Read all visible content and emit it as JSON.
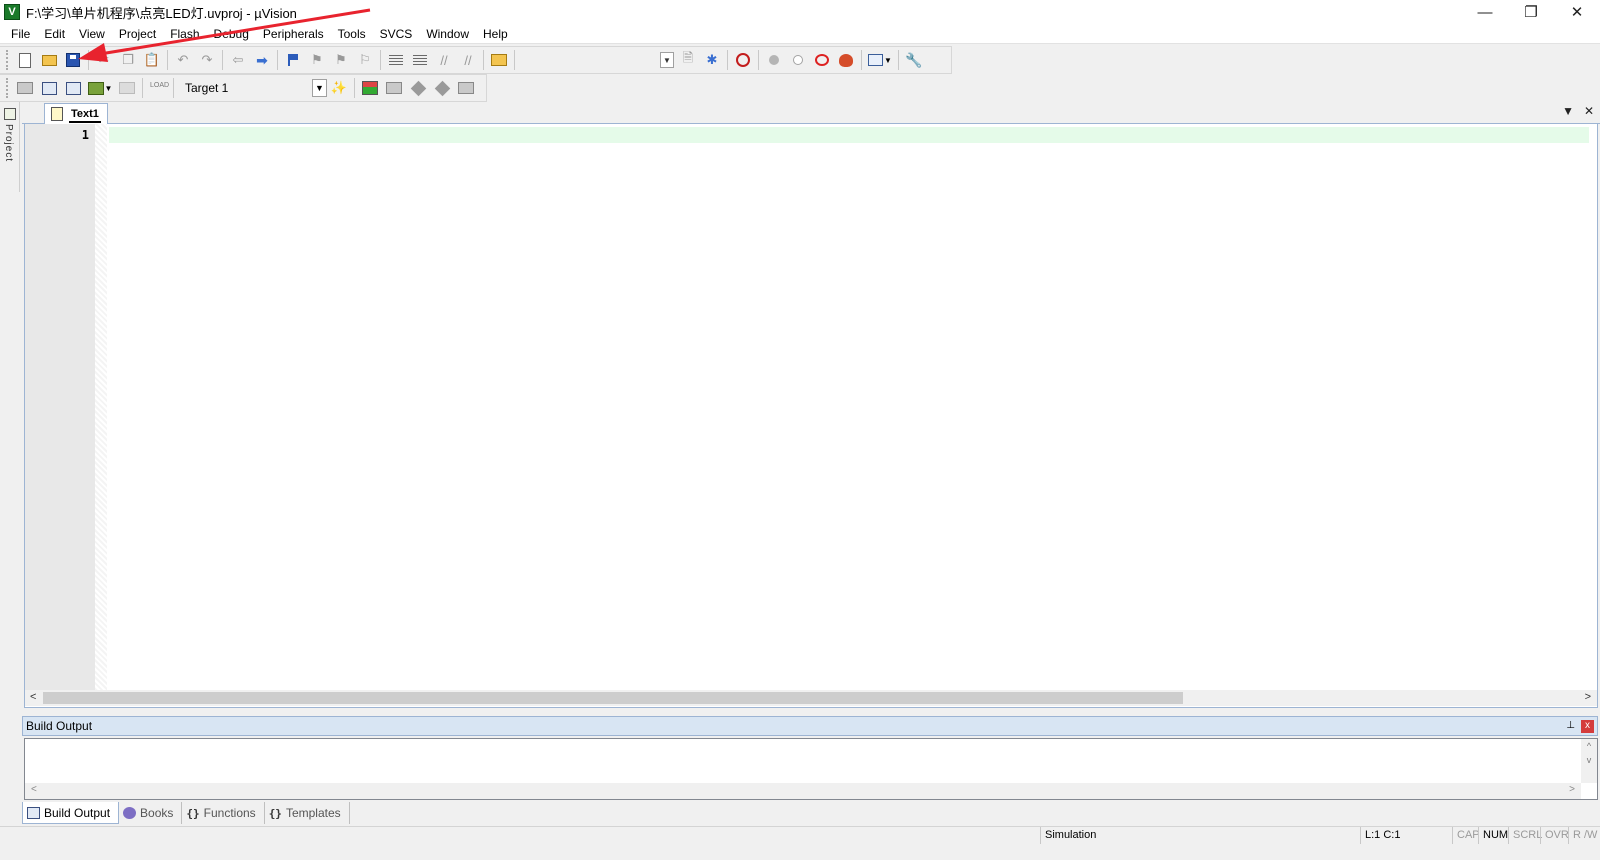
{
  "window": {
    "app_logo": "V",
    "title": "F:\\学习\\单片机程序\\点亮LED灯.uvproj - µVision",
    "controls": {
      "minimize": "—",
      "restore": "❐",
      "close": "✕"
    }
  },
  "menu": [
    "File",
    "Edit",
    "View",
    "Project",
    "Flash",
    "Debug",
    "Peripherals",
    "Tools",
    "SVCS",
    "Window",
    "Help"
  ],
  "toolbar2": {
    "target_label": "Target 1",
    "load_label": "LOAD"
  },
  "left_strip": {
    "label": "Project"
  },
  "editor": {
    "tab_label": "Text1",
    "line_numbers": [
      "1"
    ],
    "tab_menu_icon": "▼",
    "tab_close_icon": "✕"
  },
  "output": {
    "title": "Build Output",
    "pin_icon": "📌",
    "close_icon": "x"
  },
  "bottom_tabs": [
    {
      "label": "Build Output",
      "icon": "build-output-icon",
      "active": true
    },
    {
      "label": "Books",
      "icon": "books-icon",
      "active": false
    },
    {
      "label": "Functions",
      "icon": "functions-icon",
      "active": false
    },
    {
      "label": "Templates",
      "icon": "templates-icon",
      "active": false
    }
  ],
  "bottom_tab_glyphs": {
    "functions": "{}",
    "templates": "{}"
  },
  "status": {
    "mode": "Simulation",
    "position": "L:1 C:1",
    "cap": "CAP",
    "num": "NUM",
    "scrl": "SCRL",
    "ovr": "OVR",
    "rw": "R /W"
  },
  "colors": {
    "current_line": "#e5fbe9",
    "annotation_arrow": "#e8232e"
  }
}
